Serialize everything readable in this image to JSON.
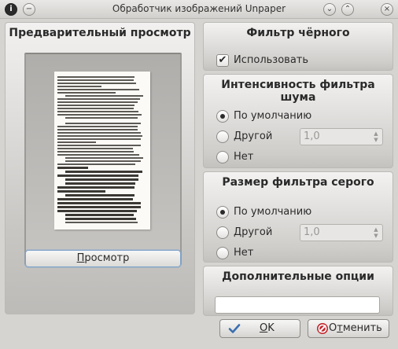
{
  "window": {
    "title": "Обработчик изображений Unpaper",
    "menu_icon_glyph": "i",
    "sticky_glyph": "−",
    "minimize_glyph": "⌄",
    "maximize_glyph": "⌃",
    "close_glyph": "×"
  },
  "preview": {
    "title": "Предварительный просмотр",
    "button_label_mnemonic": "П",
    "button_label_rest": "росмотр"
  },
  "black_filter": {
    "title": "Фильтр чёрного",
    "use_label": "Использовать",
    "use_checked": true,
    "check_glyph": "✔"
  },
  "noise_filter": {
    "title": "Интенсивность фильтра шума",
    "options": [
      "По умолчанию",
      "Другой",
      "Нет"
    ],
    "selected_index": 0,
    "custom_value": "1,0",
    "spin_up": "▲",
    "spin_down": "▼"
  },
  "gray_filter": {
    "title": "Размер фильтра серого",
    "options": [
      "По умолчанию",
      "Другой",
      "Нет"
    ],
    "selected_index": 0,
    "custom_value": "1,0",
    "spin_up": "▲",
    "spin_down": "▼"
  },
  "extra_options": {
    "title": "Дополнительные опции",
    "value": ""
  },
  "buttons": {
    "ok_mnemonic": "O",
    "ok_rest": "K",
    "cancel_prefix": "О",
    "cancel_mnemonic": "т",
    "cancel_rest": "менить"
  },
  "colors": {
    "ok_icon": "#3a6fb0",
    "cancel_icon": "#c0262b",
    "focus_border": "#7fa3c8"
  }
}
